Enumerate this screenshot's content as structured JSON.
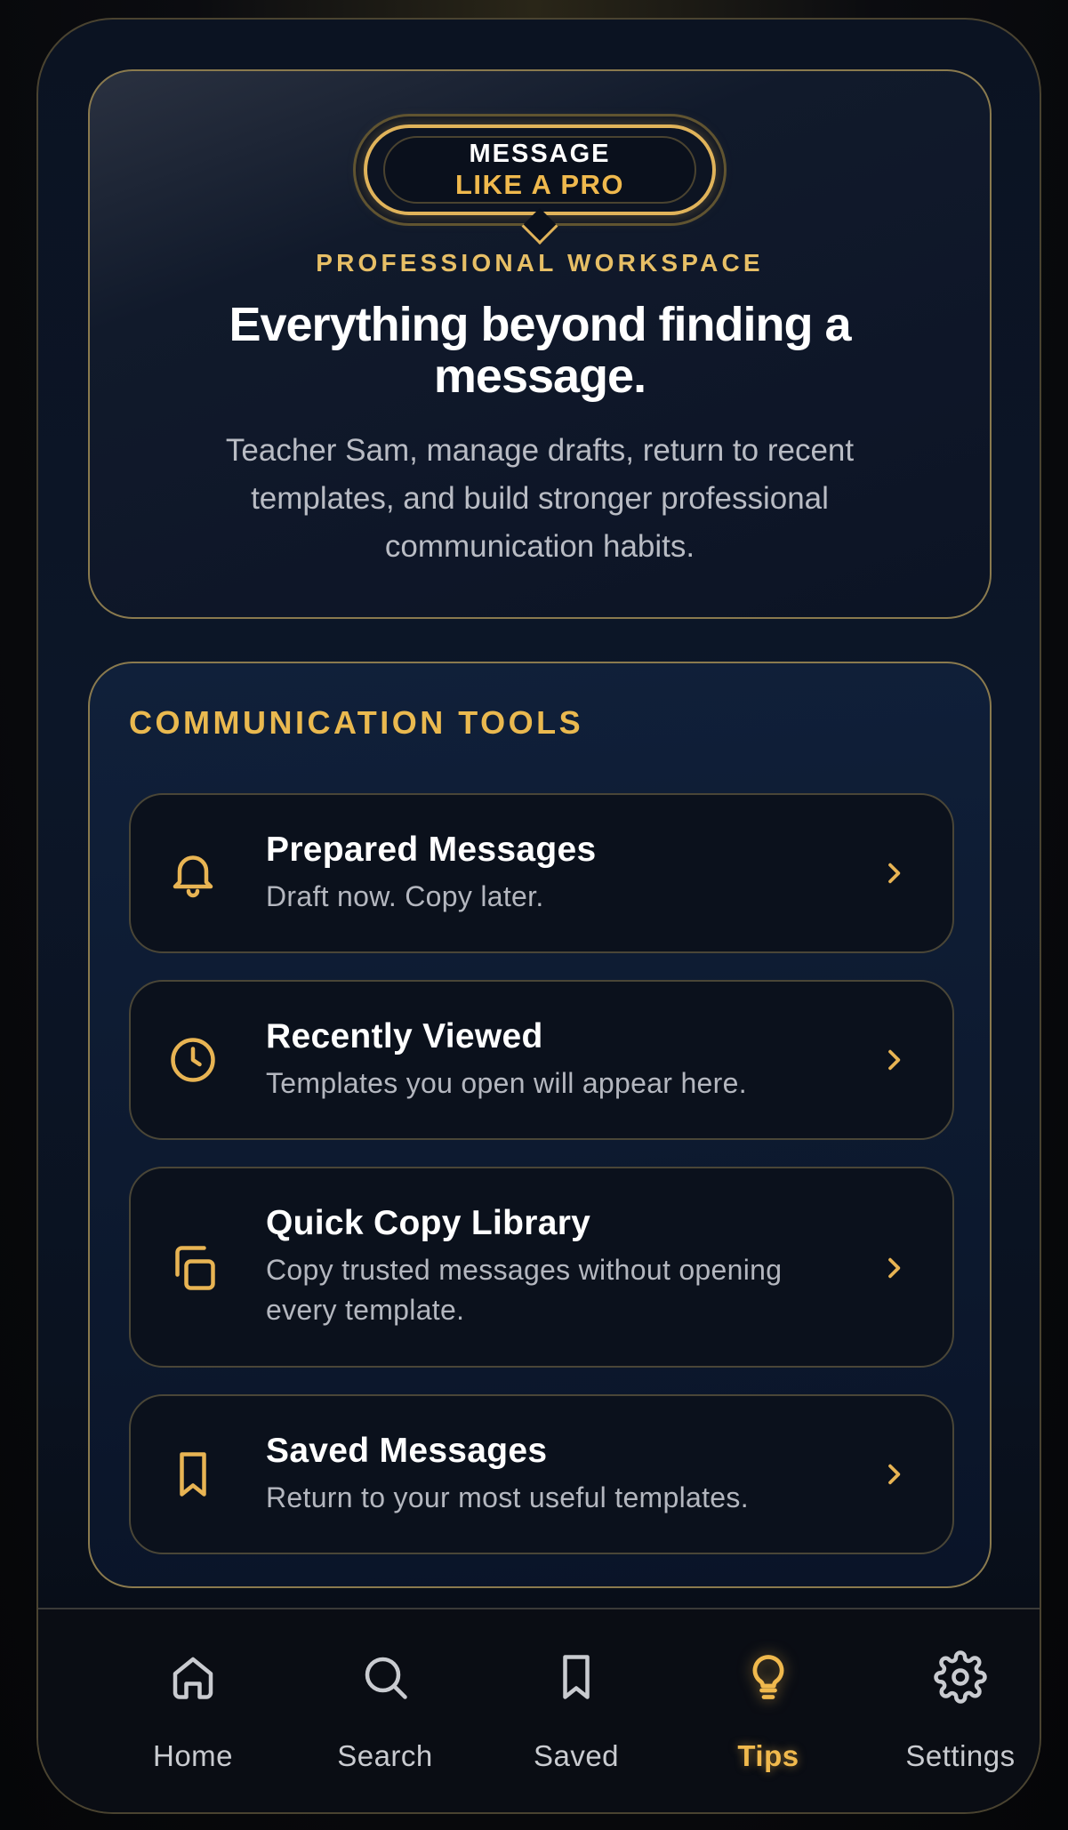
{
  "hero": {
    "badge_line1": "MESSAGE",
    "badge_line2": "LIKE A PRO",
    "eyebrow": "PROFESSIONAL WORKSPACE",
    "title": "Everything beyond finding a message.",
    "description": "Teacher Sam, manage drafts, return to recent templates, and build stronger professional communication habits."
  },
  "tools": {
    "section_title": "COMMUNICATION TOOLS",
    "items": [
      {
        "title": "Prepared Messages",
        "subtitle": "Draft now. Copy later.",
        "icon": "bell-icon"
      },
      {
        "title": "Recently Viewed",
        "subtitle": "Templates you open will appear here.",
        "icon": "clock-icon"
      },
      {
        "title": "Quick Copy Library",
        "subtitle": "Copy trusted messages without opening every template.",
        "icon": "copy-icon"
      },
      {
        "title": "Saved Messages",
        "subtitle": "Return to your most useful templates.",
        "icon": "bookmark-icon"
      }
    ]
  },
  "nav": {
    "items": [
      {
        "label": "Home",
        "icon": "home-icon",
        "active": false
      },
      {
        "label": "Search",
        "icon": "search-icon",
        "active": false
      },
      {
        "label": "Saved",
        "icon": "bookmark-icon",
        "active": false
      },
      {
        "label": "Tips",
        "icon": "lightbulb-icon",
        "active": true
      },
      {
        "label": "Settings",
        "icon": "gear-icon",
        "active": false
      }
    ]
  },
  "colors": {
    "accent_gold": "#f0b94d",
    "background_navy": "#0c1628",
    "border_gold": "#8a7a4e"
  }
}
